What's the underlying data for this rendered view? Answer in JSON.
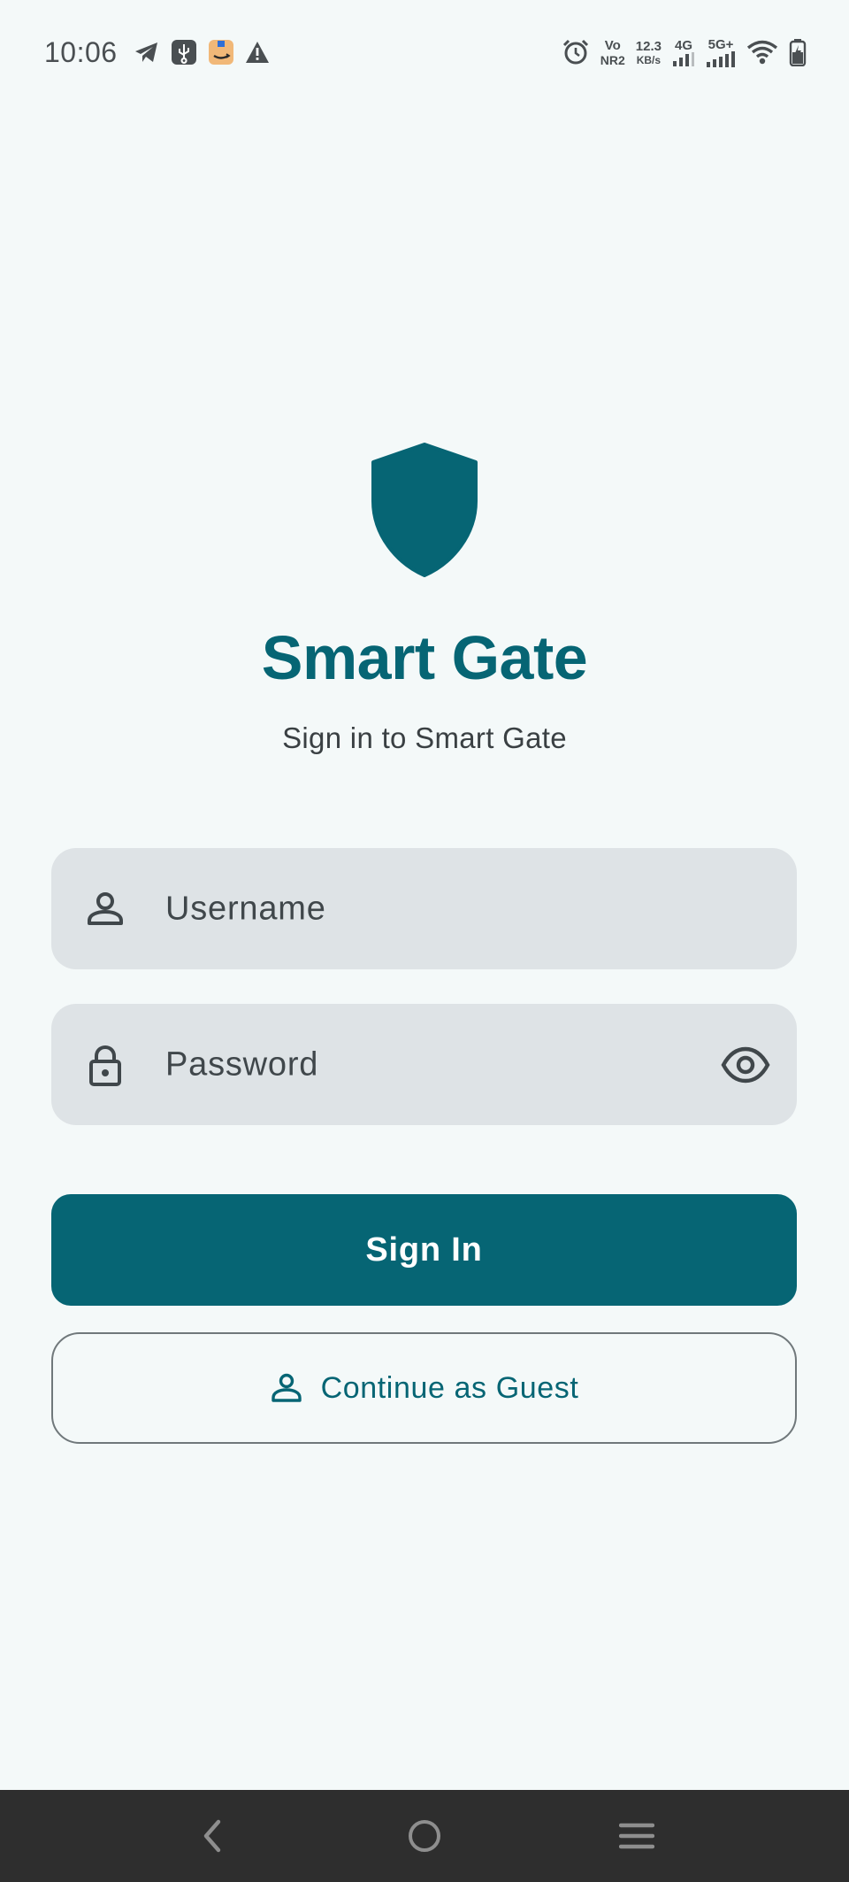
{
  "status_bar": {
    "time": "10:06",
    "network_top": "Vo",
    "network_bottom": "NR2",
    "speed_value": "12.3",
    "speed_unit": "KB/s",
    "signal_1_label": "4G",
    "signal_2_label": "5G+",
    "left_icons": [
      "telegram-icon",
      "usb-icon",
      "amazon-icon",
      "warning-icon"
    ],
    "right_icons": [
      "alarm-icon",
      "signal-icon",
      "wifi-icon",
      "battery-icon"
    ]
  },
  "app": {
    "logo_icon": "shield-icon",
    "title": "Smart Gate",
    "subtitle": "Sign in to Smart Gate"
  },
  "form": {
    "username_placeholder": "Username",
    "password_placeholder": "Password",
    "sign_in_label": "Sign In",
    "guest_label": "Continue as Guest"
  },
  "colors": {
    "primary": "#066574",
    "background": "#f4f9f9",
    "field_background": "#dee3e6",
    "nav_bar": "#2e2e2e"
  },
  "nav": {
    "icons": [
      "back-icon",
      "home-icon",
      "menu-icon"
    ]
  }
}
